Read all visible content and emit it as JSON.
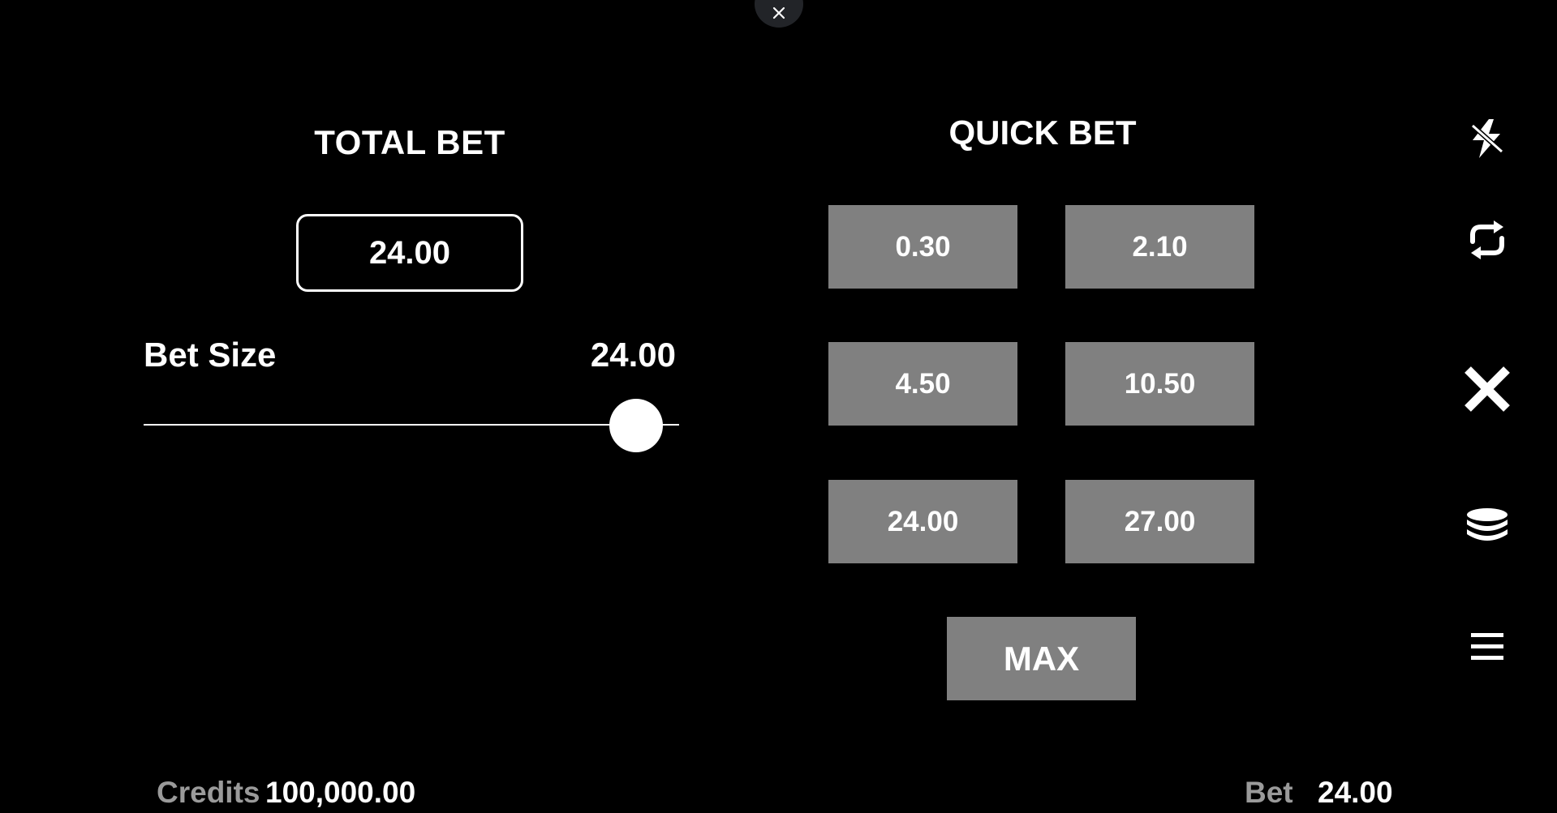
{
  "total_bet": {
    "title": "TOTAL BET",
    "value": "24.00"
  },
  "bet_size": {
    "label": "Bet Size",
    "value": "24.00",
    "slider_level": 0.92
  },
  "quick_bet": {
    "title": "QUICK BET",
    "options": [
      "0.30",
      "2.10",
      "4.50",
      "10.50",
      "24.00",
      "27.00"
    ],
    "max_label": "MAX"
  },
  "side_icons": [
    "turbo-icon",
    "autoplay-icon",
    "close-icon",
    "coin-stack-icon",
    "menu-icon"
  ],
  "footer": {
    "credits_label": "Credits",
    "credits_value": "100,000.00",
    "bet_label": "Bet",
    "bet_value": "24.00"
  },
  "colors": {
    "background": "#000000",
    "button": "#808080",
    "muted_text": "#9a9a9a",
    "text": "#ffffff"
  }
}
